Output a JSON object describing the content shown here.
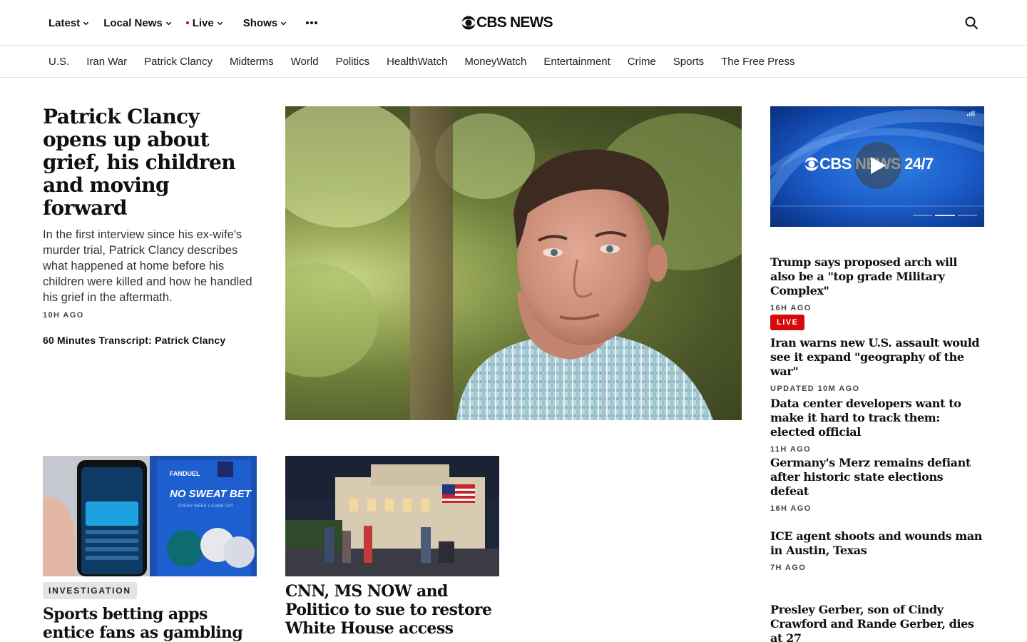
{
  "header": {
    "nav": [
      {
        "label": "Latest",
        "has_dropdown": true
      },
      {
        "label": "Local News",
        "has_dropdown": true
      },
      {
        "label": "Live",
        "has_dropdown": true,
        "live_dot": true
      },
      {
        "label": "Shows",
        "has_dropdown": true
      }
    ],
    "more_icon": "more-dots-icon",
    "logo": "CBS NEWS",
    "search_icon": "search-icon"
  },
  "sections": [
    "U.S.",
    "Iran War",
    "Patrick Clancy",
    "Midterms",
    "World",
    "Politics",
    "HealthWatch",
    "MoneyWatch",
    "Entertainment",
    "Crime",
    "Sports",
    "The Free Press"
  ],
  "lead": {
    "title": "Patrick Clancy opens up about grief, his children and moving forward",
    "dek": "In the first interview since his ex-wife's murder trial, Patrick Clancy describes what happened at home before his children were killed and how he handled his grief in the aftermath.",
    "time": "10H AGO",
    "related": "60 Minutes Transcript: Patrick Clancy"
  },
  "player": {
    "brand": "CBS NEWS 24/7",
    "play_icon": "play-icon",
    "accent": "#1d5fcc"
  },
  "side_stories": [
    {
      "title": "Trump says proposed arch will also be a \"top grade Military Complex\"",
      "time": "16H AGO"
    },
    {
      "badge": "LIVE",
      "title": "Iran warns new U.S. assault would see it expand \"geography of the war\"",
      "time": "UPDATED 10M AGO"
    },
    {
      "title": "Data center developers want to make it hard to track them: elected official",
      "time": "11H AGO"
    },
    {
      "title": "Germany's Merz remains defiant after historic state elections defeat",
      "time": "16H AGO"
    },
    {
      "title": "ICE agent shoots and wounds man in Austin, Texas",
      "time": "7H AGO"
    },
    {
      "title": "Presley Gerber, son of Cindy Crawford and Rande Gerber, dies at 27"
    }
  ],
  "cards": [
    {
      "tag": "INVESTIGATION",
      "title": "Sports betting apps entice fans as gambling exacts a",
      "image_text": [
        "FANDUEL",
        "NO SWEAT BET",
        "EVERY WEEK 1 GAME DAY"
      ]
    },
    {
      "title": "CNN, MS NOW and Politico to sue to restore White House access"
    }
  ],
  "colors": {
    "live": "#d60a0a",
    "text": "#101010"
  }
}
